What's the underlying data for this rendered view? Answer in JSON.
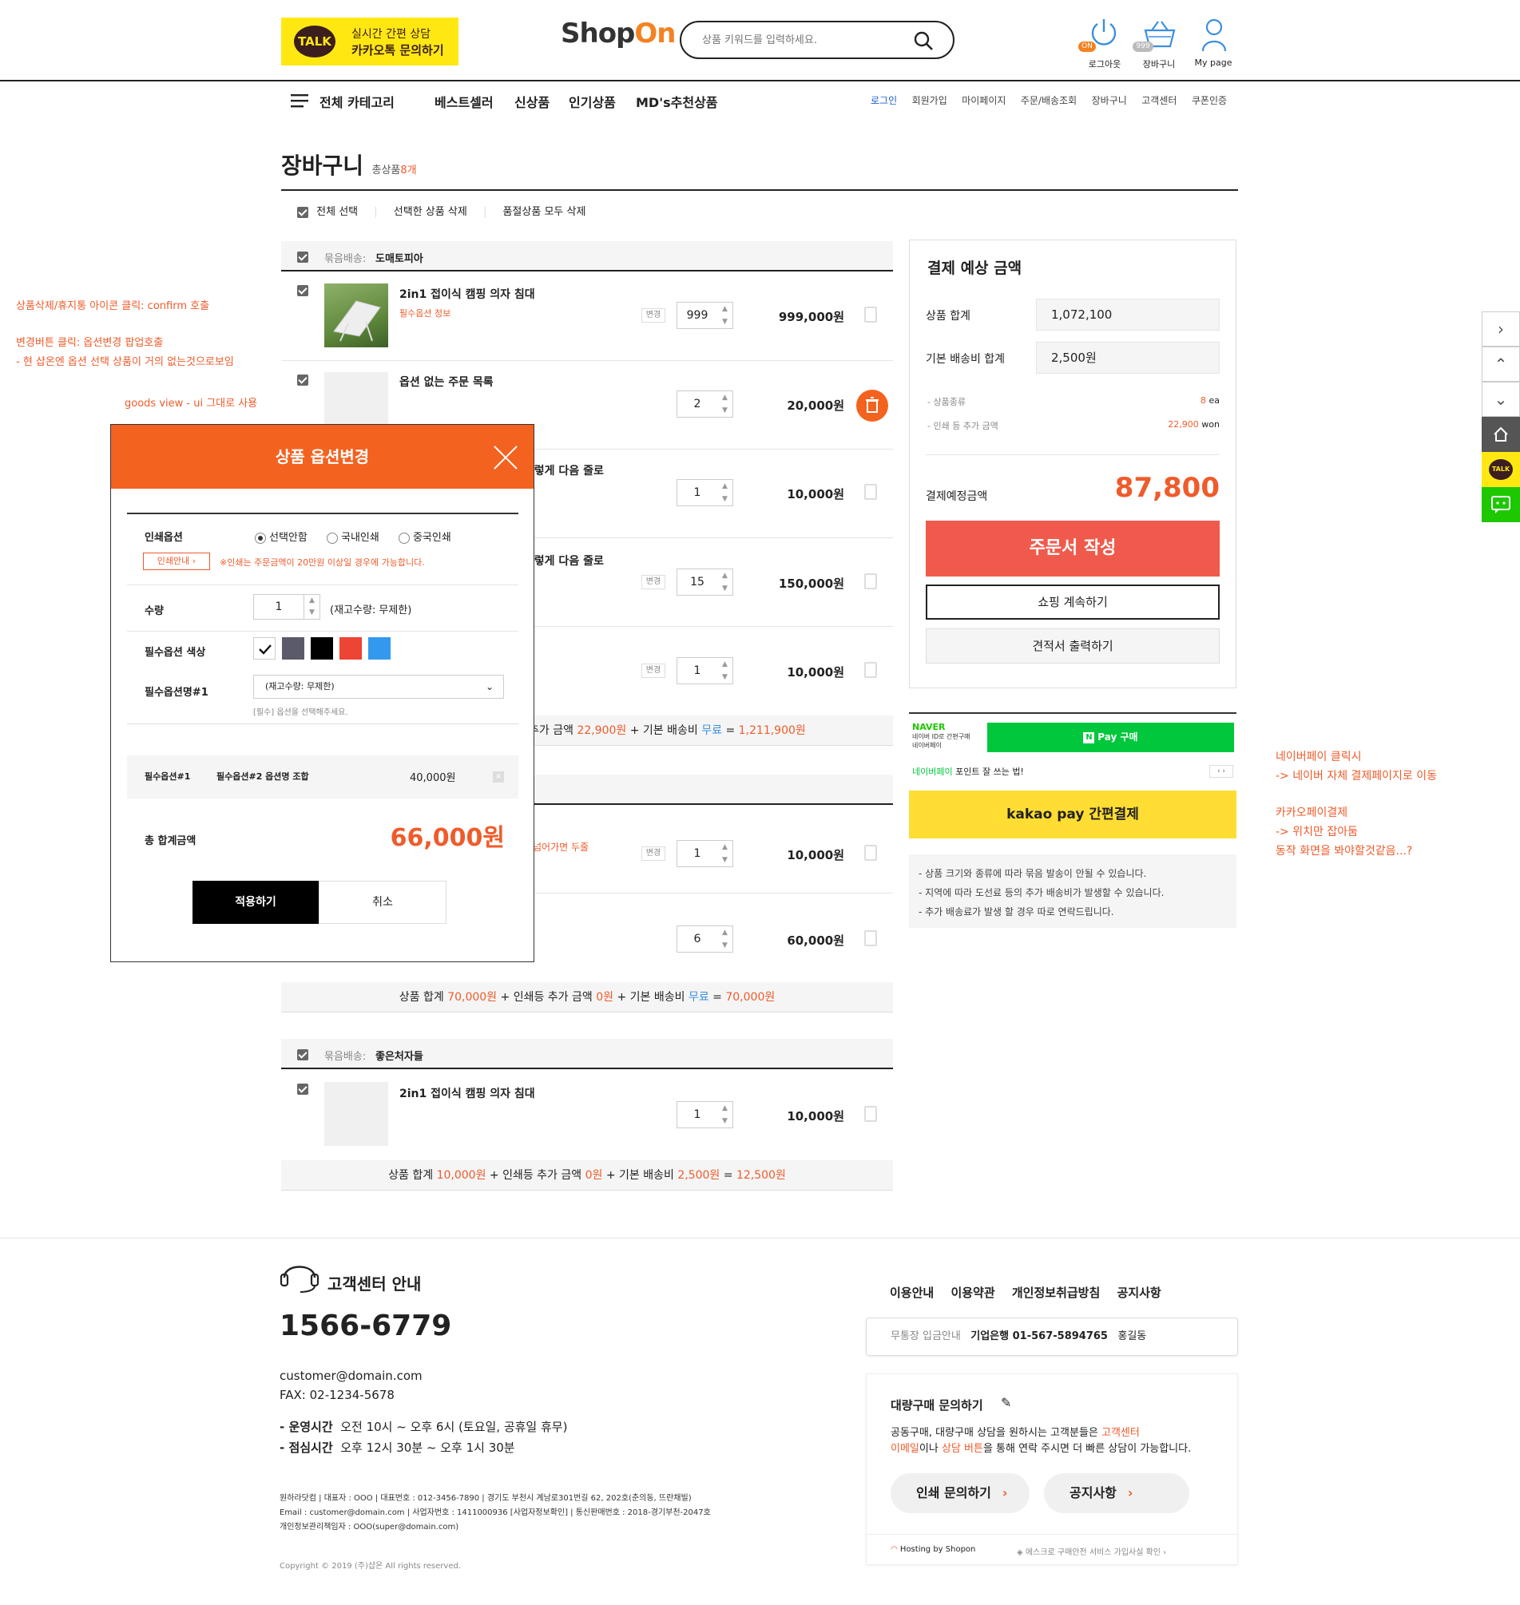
{
  "header": {
    "talk_badge": "TALK",
    "talk_line1": "실시간 간편 상담",
    "talk_line2": "카카오톡 문의하기",
    "logo_shop": "Shop",
    "logo_on": "On",
    "search_placeholder": "상품 키워드를 입력하세요.",
    "icons": [
      {
        "label": "로그아웃",
        "badge": "ON"
      },
      {
        "label": "장바구니",
        "badge": "999"
      },
      {
        "label": "My page"
      }
    ]
  },
  "nav": {
    "all_category": "전체 카테고리",
    "menu": [
      "베스트셀러",
      "신상품",
      "인기상품",
      "MD's추천상품"
    ],
    "top_links": [
      "로그인",
      "회원가입",
      "마이페이지",
      "주문/배송조회",
      "장바구니",
      "고객센터",
      "쿠폰인증"
    ]
  },
  "cart": {
    "title": "장바구니",
    "total_label": "총상품",
    "total_count": "8개",
    "actions": [
      "전체 선택",
      "선택한 상품 삭제",
      "품절상품 모두 삭제"
    ],
    "groups": [
      {
        "ship_label": "묶음배송:",
        "ship_name": "도매토피아",
        "items": [
          {
            "name": "2in1 접이식 캠핑 의자 침대",
            "sub": "필수옵션 정보",
            "change": "변경",
            "qty": "999",
            "price": "999,000원"
          },
          {
            "name": "옵션 없는 주문 목록",
            "sub": "",
            "change": "",
            "qty": "2",
            "price": "20,000원"
          },
          {
            "name": "l렇게 다음 줄로",
            "sub": "",
            "change": "",
            "qty": "1",
            "price": "10,000원"
          },
          {
            "name": "l렇게 다음 줄로",
            "sub": "",
            "change": "변경",
            "qty": "15",
            "price": "150,000원"
          },
          {
            "name": "",
            "sub": "",
            "change": "변경",
            "qty": "1",
            "price": "10,000원"
          }
        ],
        "summary": {
          "p1": "추가 금액 ",
          "v1": "22,900원",
          "p2": " + 기본 배송비 ",
          "v2": "무료",
          "p3": " = ",
          "v3": "1,211,900원"
        }
      },
      {
        "items": [
          {
            "name": "",
            "sub": "넘어가면 두줄",
            "change": "변경",
            "qty": "1",
            "price": "10,000원"
          },
          {
            "name": "",
            "sub": "",
            "change": "",
            "qty": "6",
            "price": "60,000원"
          }
        ],
        "summary": {
          "p0": "상품 합계 ",
          "v0": "70,000원",
          "p1": " + 인쇄등 추가 금액 ",
          "v1": "0원",
          "p2": "  + 기본 배송비 ",
          "v2": "무료",
          "p3": " = ",
          "v3": "70,000원"
        }
      },
      {
        "ship_label": "묶음배송:",
        "ship_name": "좋은처자들",
        "items": [
          {
            "name": "2in1 접이식 캠핑 의자 침대",
            "qty": "1",
            "price": "10,000원"
          }
        ],
        "summary": {
          "p0": "상품 합계 ",
          "v0": "10,000원",
          "p1": " + 인쇄등 추가 금액 ",
          "v1": "0원",
          "p2": "  + 기본 배송비 ",
          "v2": "2,500원",
          "p3": " = ",
          "v3": "12,500원"
        }
      }
    ]
  },
  "panel": {
    "title": "결제 예상 금액",
    "goods_total_label": "상품 합계",
    "goods_total": "1,072,100",
    "ship_total_label": "기본 배송비 합계",
    "ship_total": "2,500원",
    "kinds_label": "- 상품종류",
    "kinds_value": "8",
    "kinds_unit": "ea",
    "print_label": "- 인쇄 등 추가 금액",
    "print_value": "22,900",
    "print_unit": "won",
    "expected_label": "결제예정금액",
    "expected_value": "87,800",
    "order_btn": "주문서 작성",
    "continue_btn": "쇼핑 계속하기",
    "quote_btn": "견적서 출력하기"
  },
  "pay": {
    "naver_brand": "NAVER",
    "naver_sub1": "네이버 ID로 간편구매",
    "naver_sub2": "네이버페이",
    "npay_btn": "Pay 구매",
    "npay_n": "N",
    "naver_point_1": "네이버페이",
    "naver_point_2": " 포인트 잘 쓰는 법!",
    "kakao_btn": "kakao pay 간편결제",
    "notes": [
      "- 상품 크기와 종류에 따라 묶음 발송이 안될 수 있습니다.",
      "- 지역에 따라 도선료 등의 추가 배송비가 발생할 수 있습니다.",
      "- 추가 배송료가 발생 할 경우 따로 연락드립니다."
    ]
  },
  "annotations": {
    "left1": "상품삭제/휴지통 아이콘 클릭: confirm 호출",
    "left2": "변경버튼 클릭: 옵션변경 팝업호출",
    "left3": "- 현 샵온엔 옵션 선택 상품이 거의 없는것으로보임",
    "left4": "goods view - ui 그대로 사용",
    "right1": "네이버페이 클릭시",
    "right2": "-> 네이버 자체 결제페이지로 이동",
    "right3": "카카오페이결제",
    "right4": "-> 위치만 잡아둠",
    "right5": "동작 화면을 봐야할것같음...?"
  },
  "modal": {
    "title": "상품 옵션변경",
    "print_label": "인쇄옵션",
    "print_opts": [
      "선택안함",
      "국내인쇄",
      "중국인쇄"
    ],
    "print_guide_btn": "인쇄안내 ›",
    "print_note": "※인쇄는 주문금액이 20만원 이상일 경우에 가능합니다.",
    "qty_label": "수량",
    "qty_value": "1",
    "stock_note": "(재고수량: 무제한)",
    "color_label": "필수옵션 색상",
    "colors": [
      "#ffffff",
      "#5a5a6a",
      "#000000",
      "#ee4433",
      "#3399ee"
    ],
    "option_label": "필수옵션명#1",
    "select_value": "(재고수량: 무제한)",
    "select_hint": "[필수] 옵션을 선택해주세요.",
    "combo_a": "필수옵션#1",
    "combo_b": "필수옵션#2 옵션명 조합",
    "combo_price": "40,000원",
    "total_label": "총 합계금액",
    "total_value": "66,000원",
    "apply_btn": "적용하기",
    "cancel_btn": "취소"
  },
  "sidebar": {
    "talk": "TALK"
  },
  "footer": {
    "cs_title": "고객센터 안내",
    "phone": "1566-6779",
    "email": "customer@domain.com",
    "fax": "FAX: 02-1234-5678",
    "hours_label": "- 운영시간",
    "hours": "오전 10시 ~ 오후 6시 (토요일, 공휴일 휴무)",
    "lunch_label": "- 점심시간",
    "lunch": "오후 12시 30분 ~ 오후 1시 30분",
    "company1": "원하라닷컴  |  대표자 : OOO  |  대표번호 : 012-3456-7890  |  경기도 부천시 계남로301번길 62, 202호(춘의동, 뜨란채빌)",
    "company2": "Email : customer@domain.com  |  사업자번호 : 1411000936 [사업자정보확인]  |  통신판매번호 : 2018-경기부천-2047호",
    "company3": "개인정보관리책임자 : OOO(super@domain.com)",
    "copyright": "Copyright © 2019 (주)샵온 All rights reserved.",
    "links": [
      "이용안내",
      "이용약관",
      "개인정보취급방침",
      "공지사항"
    ],
    "bank_label": "무통장 입금안내",
    "bank_value": "기업은행 01-567-5894765",
    "bank_owner": "홍길동",
    "bulk_title": "대량구매 문의하기",
    "bulk_t1": "공동구매, 대량구매 상담을 원하시는 고객분들은 ",
    "bulk_t2": "고객센터",
    "bulk_t3": "이메일",
    "bulk_t4": "이나 ",
    "bulk_t5": "상담 버튼",
    "bulk_t6": "을 통해 연락 주시면 더 빠른 상담이 가능합니다.",
    "print_inquiry": "인쇄 문의하기",
    "notice": "공지사항",
    "hosting": "Hosting by Shopon",
    "escrow": "에스크로 구매안전 서비스 가입사실 확인 ›"
  }
}
